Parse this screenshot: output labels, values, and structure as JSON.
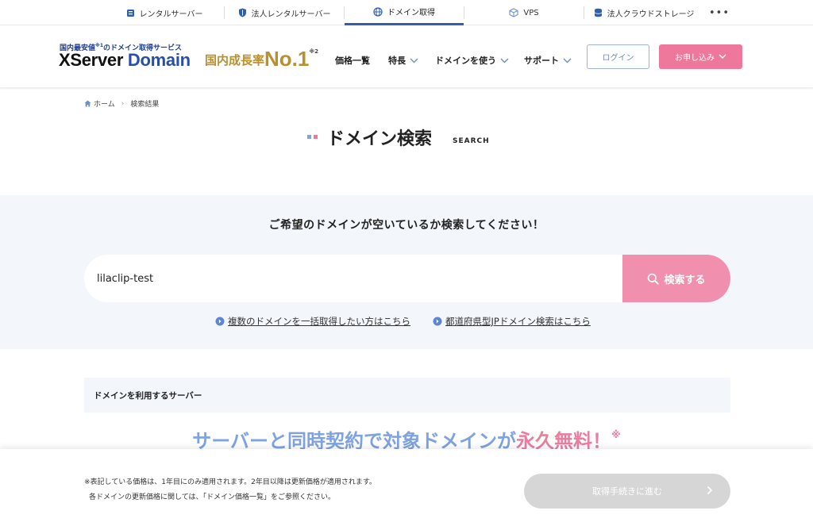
{
  "topbar": {
    "tabs": [
      {
        "label": "レンタルサーバー",
        "icon": "server-icon"
      },
      {
        "label": "法人レンタルサーバー",
        "icon": "shield-icon"
      },
      {
        "label": "ドメイン取得",
        "icon": "globe-icon",
        "active": true
      },
      {
        "label": "VPS",
        "icon": "cube-icon"
      },
      {
        "label": "法人クラウドストレージ",
        "icon": "database-icon"
      }
    ],
    "more_label": "•••"
  },
  "header": {
    "tagline_pre": "国内最安値",
    "tagline_mark": "※1",
    "tagline_post": "のドメイン取得サービス",
    "logo_x": "XServer",
    "logo_domain": "Domain",
    "rank_prefix": "国内成長率",
    "rank_value": "No.1",
    "rank_mark": "※2",
    "nav": [
      {
        "label": "価格一覧",
        "dropdown": false
      },
      {
        "label": "特長",
        "dropdown": true
      },
      {
        "label": "ドメインを使う",
        "dropdown": true
      },
      {
        "label": "サポート",
        "dropdown": true
      }
    ],
    "login_label": "ログイン",
    "apply_label": "お申し込み"
  },
  "breadcrumb": {
    "home": "ホーム",
    "current": "検索結果"
  },
  "page": {
    "title": "ドメイン検索",
    "subtitle": "SEARCH"
  },
  "search": {
    "lead": "ご希望のドメインが空いているか検索してください！",
    "value": "lilaclip-test",
    "placeholder": "",
    "button_label": "検索する",
    "link_bulk": "複数のドメインを一括取得したい方はこちら",
    "link_prefecture": "都道府県型JPドメイン検索はこちら"
  },
  "server_section": {
    "heading": "ドメインを利用するサーバー",
    "promo_main": "サーバーと同時契約で対象ドメインが",
    "promo_highlight": "永久無料！",
    "promo_mark": "※"
  },
  "footer_bar": {
    "note1": "※表記している価格は、1年目にのみ適用されます。2年目以降は更新価格が適用されます。",
    "note2": "各ドメインの更新価格に関しては、「ドメイン価格一覧」をご参照ください。",
    "proceed_label": "取得手続きに進む"
  },
  "colors": {
    "brand_blue": "#2a4ea8",
    "accent_pink": "#ee779c",
    "gold": "#b8902e",
    "section_bg": "#f3f6fa",
    "disabled": "#d6d6d6"
  }
}
